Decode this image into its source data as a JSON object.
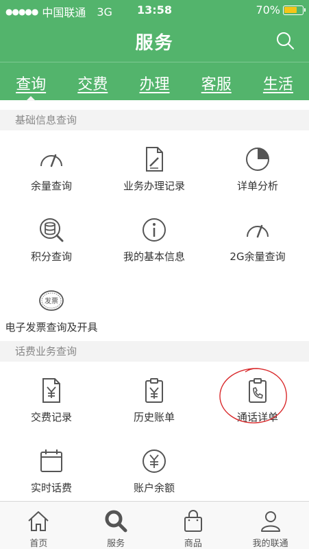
{
  "status_bar": {
    "signal_dots": "●●●●●",
    "carrier": "中国联通",
    "network": "3G",
    "time": "13:58",
    "battery_percent_text": "70%",
    "battery_level": 0.7
  },
  "nav": {
    "title": "服务",
    "search_icon": "search-icon"
  },
  "tabs": [
    {
      "label": "查询",
      "active": true
    },
    {
      "label": "交费",
      "active": false
    },
    {
      "label": "办理",
      "active": false
    },
    {
      "label": "客服",
      "active": false
    },
    {
      "label": "生活",
      "active": false
    }
  ],
  "sections": [
    {
      "title": "基础信息查询",
      "items": [
        {
          "label": "余量查询",
          "icon": "gauge-icon"
        },
        {
          "label": "业务办理记录",
          "icon": "document-edit-icon"
        },
        {
          "label": "详单分析",
          "icon": "pie-chart-icon"
        },
        {
          "label": "积分查询",
          "icon": "coins-search-icon"
        },
        {
          "label": "我的基本信息",
          "icon": "info-icon"
        },
        {
          "label": "2G余量查询",
          "icon": "gauge-icon"
        },
        {
          "label": "电子发票查询及开具",
          "icon": "invoice-stamp-icon",
          "icon_text": "发票"
        }
      ]
    },
    {
      "title": "话费业务查询",
      "items": [
        {
          "label": "交费记录",
          "icon": "yuan-document-icon"
        },
        {
          "label": "历史账单",
          "icon": "yuan-clipboard-icon"
        },
        {
          "label": "通话详单",
          "icon": "phone-clipboard-icon"
        },
        {
          "label": "实时话费",
          "icon": "calendar-icon"
        },
        {
          "label": "账户余额",
          "icon": "yuan-circle-icon"
        }
      ]
    }
  ],
  "tabbar": [
    {
      "label": "首页",
      "icon": "home-icon"
    },
    {
      "label": "服务",
      "icon": "service-search-icon",
      "active": true
    },
    {
      "label": "商品",
      "icon": "shopping-bag-icon"
    },
    {
      "label": "我的联通",
      "icon": "user-icon"
    }
  ],
  "colors": {
    "brand_green": "#53b46c",
    "section_bg": "#f3f3f3",
    "annotation_red": "#d9292b",
    "battery_yellow": "#f5c518"
  }
}
